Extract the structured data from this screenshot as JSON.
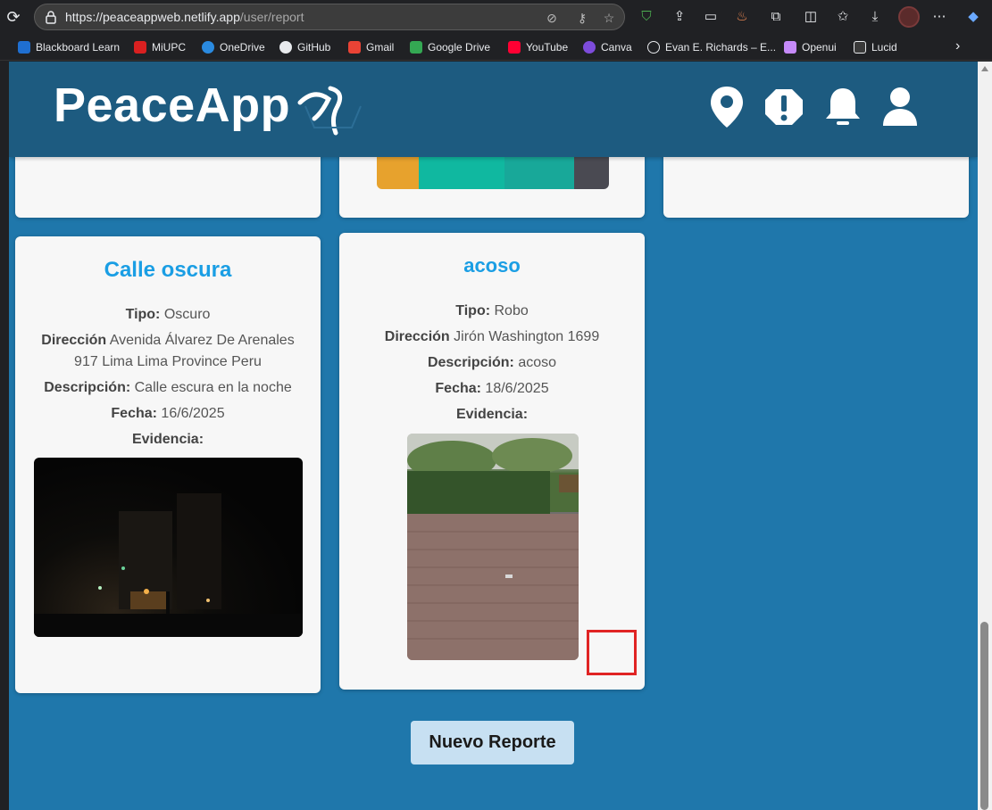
{
  "browser": {
    "url_host": "https://peaceappweb.netlify.app",
    "url_path": "/user/report",
    "bookmarks": [
      {
        "label": "Blackboard Learn",
        "color": "#1f6fd1"
      },
      {
        "label": "MiUPC",
        "color": "#d92020"
      },
      {
        "label": "OneDrive",
        "color": "#2a8ae0"
      },
      {
        "label": "GitHub",
        "color": "#e8eaed"
      },
      {
        "label": "Gmail",
        "color": "#ea4335"
      },
      {
        "label": "Google Drive",
        "color": "#34a853"
      },
      {
        "label": "YouTube",
        "color": "#ff0033"
      },
      {
        "label": "Canva",
        "color": "#7d4cdb"
      },
      {
        "label": "Evan E. Richards – E...",
        "color": "#e8eaed"
      },
      {
        "label": "Openui",
        "color": "#c58af9"
      },
      {
        "label": "Lucid",
        "color": "#e8eaed"
      }
    ]
  },
  "app": {
    "logo": "PeaceApp",
    "nav_icons": [
      "location-pin-icon",
      "alert-icon",
      "bell-icon",
      "user-icon"
    ]
  },
  "reports": [
    {
      "title": "Calle oscura",
      "tipo_label": "Tipo:",
      "tipo": "Oscuro",
      "direccion_label": "Dirección",
      "direccion_1": "Avenida Álvarez De Arenales",
      "direccion_2": "917 Lima Lima Province Peru",
      "descripcion_label": "Descripción:",
      "descripcion": "Calle escura en la noche",
      "fecha_label": "Fecha:",
      "fecha": "16/6/2025",
      "evidencia_label": "Evidencia:"
    },
    {
      "title": "acoso",
      "tipo_label": "Tipo:",
      "tipo": "Robo",
      "direccion_label": "Dirección",
      "direccion_1": "Jirón Washington 1699",
      "descripcion_label": "Descripción:",
      "descripcion": "acoso",
      "fecha_label": "Fecha:",
      "fecha": "18/6/2025",
      "evidencia_label": "Evidencia:"
    }
  ],
  "actions": {
    "new_report": "Nuevo Reporte"
  },
  "colors": {
    "page_bg": "#1f77ab",
    "header_bg": "#1d5b80",
    "title_accent": "#1a9ee4",
    "button_bg": "#c7e0f2",
    "selection": "#e02424"
  }
}
